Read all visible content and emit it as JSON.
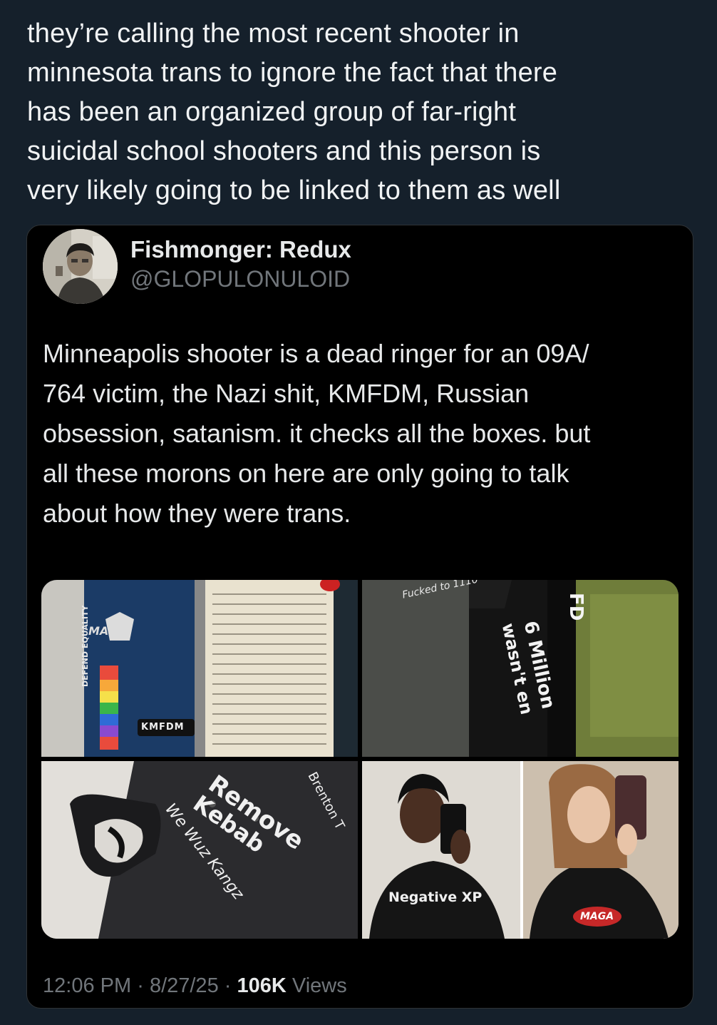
{
  "post": {
    "text": "they’re calling the most recent shooter in\nminnesota trans to ignore the fact that there\nhas been an organized group of far-right\nsuicidal school shooters and this person is\nvery likely going to be linked to them as well"
  },
  "quoted_tweet": {
    "author_name": "Fishmonger: Redux",
    "author_handle": "@GLOPULONULOID",
    "avatar_icon": "profile-photo",
    "body": "Minneapolis shooter is a dead ringer for an 09A/\n764 victim, the Nazi shit, KMFDM, Russian\nobsession, satanism. it checks all the boxes. but\nall these morons on here are only going to talk\nabout how they were trans.",
    "media": {
      "photo1_texts": [
        "DEFEND EQUALITY",
        "KMFDM",
        "MA"
      ],
      "photo2_texts": [
        "6 Million",
        "wasn't en",
        "FD",
        "Fucked to 1110"
      ],
      "photo3_texts": [
        "Remove",
        "Kebab",
        "We Wuz Kangz",
        "Brenton T"
      ],
      "photo4_texts": [
        "Negative XP",
        "MAGA"
      ]
    },
    "time": "12:06 PM",
    "separator": "·",
    "date": "8/27/25",
    "views_count": "106K",
    "views_label": "Views"
  },
  "colors": {
    "background": "#15202b",
    "card": "#000000",
    "text_primary": "#e7e9ea",
    "text_secondary": "#71767b",
    "border": "#2f3336"
  }
}
